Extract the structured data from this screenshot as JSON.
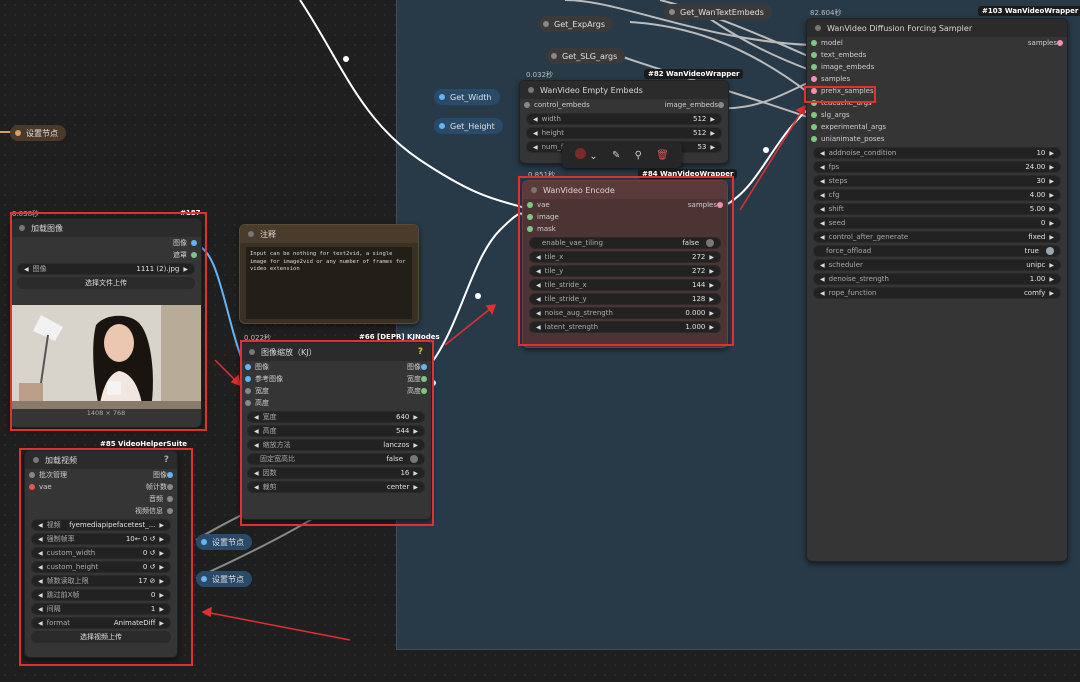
{
  "reroutes": {
    "set_node_left": "设置节点",
    "set_node_1": "设置节点",
    "set_node_2": "设置节点",
    "get_width": "Get_Width",
    "get_height": "Get_Height",
    "get_expargs": "Get_ExpArgs",
    "get_slgargs": "Get_SLG_args",
    "get_wantextembeds": "Get_WanTextEmbeds"
  },
  "load_image": {
    "tag": "#187",
    "timing": "0.038秒",
    "title": "加载图像",
    "out_image": "图像",
    "out_mask": "遮罩",
    "file_label": "图像",
    "file_value": "1111 (2).jpg",
    "upload_btn": "选择文件上传",
    "dims": "1408 × 768"
  },
  "note": {
    "title": "注释",
    "text": "Input can be nothing for text2vid, a single image for image2vid or any number of frames for video extension"
  },
  "resize": {
    "timing": "0.022秒",
    "tag": "#66 [DEPR] KJNodes",
    "title": "图像缩放（KJ）",
    "help": "?",
    "in_image": "图像",
    "in_ref": "参考图像",
    "in_width": "宽度",
    "in_height": "高度",
    "out_image": "图像",
    "out_width": "宽度",
    "out_height": "高度",
    "widgets": [
      {
        "label": "宽度",
        "value": "640"
      },
      {
        "label": "高度",
        "value": "544"
      },
      {
        "label": "缩放方法",
        "value": "lanczos"
      },
      {
        "label": "固定宽高比",
        "value": "false",
        "toggle": true
      },
      {
        "label": "因数",
        "value": "16"
      },
      {
        "label": "裁剪",
        "value": "center"
      }
    ]
  },
  "load_video": {
    "tag": "#85 VideoHelperSuite",
    "title": "加载视频",
    "help": "?",
    "in_batch": "批次管理",
    "in_vae": "vae",
    "out_image": "图像",
    "out_frames": "帧计数",
    "out_audio": "音频",
    "out_info": "视频信息",
    "widgets": [
      {
        "label": "视频",
        "value": "fyemediapipefacetest_..."
      },
      {
        "label": "强制帧率",
        "value": "10←  0 ↺"
      },
      {
        "label": "custom_width",
        "value": "0 ↺"
      },
      {
        "label": "custom_height",
        "value": "0 ↺"
      },
      {
        "label": "帧数读取上限",
        "value": "17 ⊘"
      },
      {
        "label": "跳过前X帧",
        "value": "0"
      },
      {
        "label": "间隔",
        "value": "1"
      },
      {
        "label": "format",
        "value": "AnimateDiff"
      }
    ],
    "upload_btn": "选择视频上传"
  },
  "empty_embeds": {
    "timing": "0.032秒",
    "tag": "#82 WanVideoWrapper",
    "title": "WanVideo Empty Embeds",
    "in_control": "control_embeds",
    "out_image": "image_embeds",
    "widgets": [
      {
        "label": "width",
        "value": "512"
      },
      {
        "label": "height",
        "value": "512"
      },
      {
        "label": "num_frames",
        "value": "53"
      }
    ]
  },
  "encode": {
    "timing": "0.851秒",
    "tag": "#84 WanVideoWrapper",
    "title": "WanVideo Encode",
    "in_vae": "vae",
    "in_image": "image",
    "in_mask": "mask",
    "out_samples": "samples",
    "widgets": [
      {
        "label": "enable_vae_tiling",
        "value": "false",
        "toggle": true
      },
      {
        "label": "tile_x",
        "value": "272"
      },
      {
        "label": "tile_y",
        "value": "272"
      },
      {
        "label": "tile_stride_x",
        "value": "144"
      },
      {
        "label": "tile_stride_y",
        "value": "128"
      },
      {
        "label": "noise_aug_strength",
        "value": "0.000"
      },
      {
        "label": "latent_strength",
        "value": "1.000"
      }
    ]
  },
  "sampler": {
    "timing": "82.604秒",
    "tag": "#103 WanVideoWrapper",
    "title": "WanVideo Diffusion Forcing Sampler",
    "out_samples": "samples",
    "inputs": [
      "model",
      "text_embeds",
      "image_embeds",
      "samples",
      "prefix_samples",
      "teacache_args",
      "slg_args",
      "experimental_args",
      "unianimate_poses"
    ],
    "widgets": [
      {
        "label": "addnoise_condition",
        "value": "10"
      },
      {
        "label": "fps",
        "value": "24.00"
      },
      {
        "label": "steps",
        "value": "30"
      },
      {
        "label": "cfg",
        "value": "4.00"
      },
      {
        "label": "shift",
        "value": "5.00"
      },
      {
        "label": "seed",
        "value": "0"
      },
      {
        "label": "control_after_generate",
        "value": "fixed"
      },
      {
        "label": "force_offload",
        "value": "true",
        "toggle": true
      },
      {
        "label": "scheduler",
        "value": "unipc"
      },
      {
        "label": "denoise_strength",
        "value": "1.00"
      },
      {
        "label": "rope_function",
        "value": "comfy"
      }
    ]
  },
  "toolbar": {
    "color_icon": "color-swatch-icon",
    "bypass_icon": "wand-icon",
    "pin_icon": "pin-icon",
    "delete_icon": "trash-icon"
  },
  "colors": {
    "image_slot": "#64b5f6",
    "mask_slot": "#81c784",
    "vae_slot": "#ef5350",
    "latent_slot": "#f48fb1",
    "highlight": "#e03030",
    "encode_bg": "#5a3a3a"
  }
}
